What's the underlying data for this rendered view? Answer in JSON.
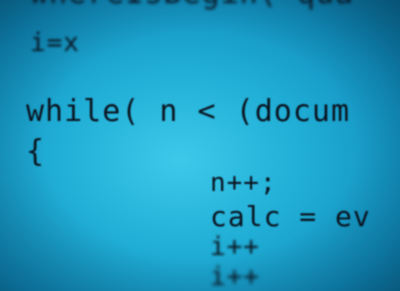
{
  "code_lines": [
    "whereIsBegin( qua",
    "i=x",
    "while( n < (docum",
    "{",
    "n++;",
    "calc = ev",
    "i++",
    "i++"
  ]
}
